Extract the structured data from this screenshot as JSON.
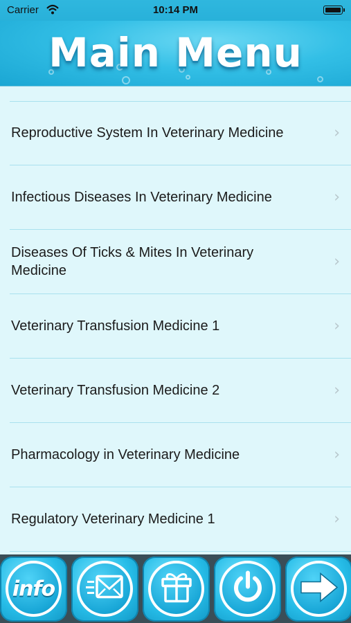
{
  "status_bar": {
    "carrier": "Carrier",
    "time": "10:14 PM",
    "wifi_icon": "wifi-icon",
    "battery_icon": "battery-icon"
  },
  "header": {
    "title": "Main Menu"
  },
  "menu": {
    "items": [
      {
        "label": "Reproductive System In Veterinary Medicine"
      },
      {
        "label": "Infectious Diseases In Veterinary Medicine"
      },
      {
        "label": "Diseases Of Ticks & Mites In Veterinary Medicine"
      },
      {
        "label": "Veterinary Transfusion Medicine 1"
      },
      {
        "label": "Veterinary Transfusion Medicine 2"
      },
      {
        "label": "Pharmacology in Veterinary Medicine"
      },
      {
        "label": "Regulatory Veterinary Medicine 1"
      }
    ],
    "chevron": "›"
  },
  "toolbar": {
    "info_label": "info",
    "buttons": [
      "info-icon",
      "mail-icon",
      "gift-icon",
      "power-icon",
      "arrow-right-icon"
    ]
  },
  "colors": {
    "accent": "#27bde8",
    "background": "#dff7fb",
    "toolbar": "#3a4e57"
  }
}
